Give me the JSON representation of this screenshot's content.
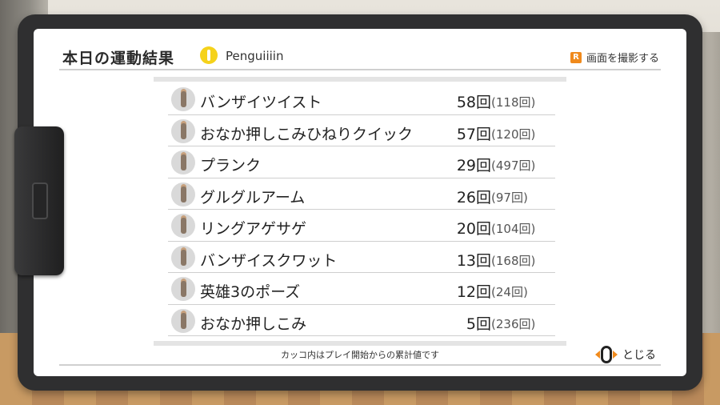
{
  "header": {
    "title": "本日の運動結果",
    "username": "Penguiiiin",
    "capture_label": "画面を撮影する",
    "capture_key": "R"
  },
  "exercises": [
    {
      "name": "バンザイツイスト",
      "count": "58回",
      "total": "(118回)"
    },
    {
      "name": "おなか押しこみひねりクイック",
      "count": "57回",
      "total": "(120回)"
    },
    {
      "name": "プランク",
      "count": "29回",
      "total": "(497回)"
    },
    {
      "name": "グルグルアーム",
      "count": "26回",
      "total": "(97回)"
    },
    {
      "name": "リングアゲサゲ",
      "count": "20回",
      "total": "(104回)"
    },
    {
      "name": "バンザイスクワット",
      "count": "13回",
      "total": "(168回)"
    },
    {
      "name": "英雄3のポーズ",
      "count": "12回",
      "total": "(24回)"
    },
    {
      "name": "おなか押しこみ",
      "count": "5回",
      "total": "(236回)"
    }
  ],
  "footer": {
    "note": "カッコ内はプレイ開始からの累計値です",
    "close_label": "とじる"
  },
  "colors": {
    "accent": "#f08a1c",
    "avatar": "#f5d21b"
  }
}
